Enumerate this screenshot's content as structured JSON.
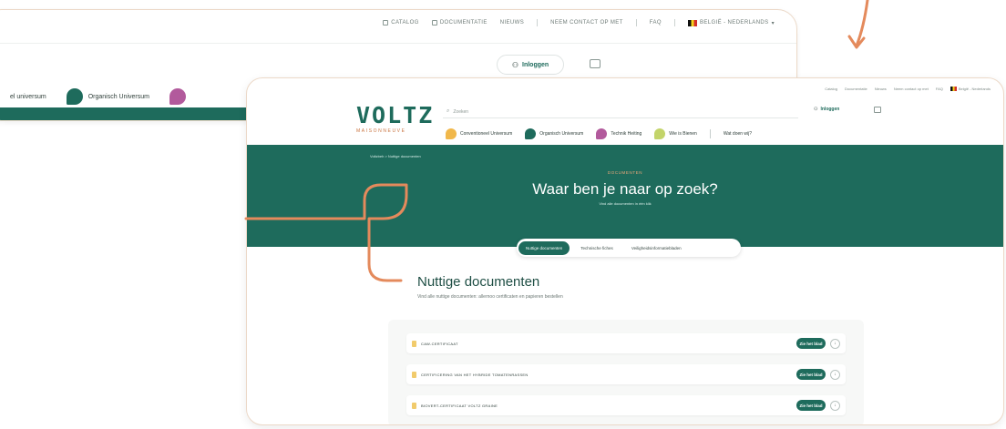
{
  "back_card": {
    "topbar": [
      "CATALOG",
      "DOCUMENTATIE",
      "NIEUWS",
      "NEEM CONTACT OP MET",
      "FAQ",
      "BELGIË - NEDERLANDS"
    ],
    "login": "Inloggen",
    "categories": [
      "el universum",
      "Organisch Universum"
    ]
  },
  "front_card": {
    "topbar": [
      "Catalog",
      "Documentatie",
      "Nieuws",
      "Neem contact op met",
      "FAQ",
      "België - Nederlands"
    ],
    "logo": {
      "name": "VOLTZ",
      "sub": "MAISONNEUVE"
    },
    "search_placeholder": "Zoeken",
    "login": "Inloggen",
    "categories": [
      {
        "label": "Conventioneel Universum",
        "color": "#f1b84b"
      },
      {
        "label": "Organisch Universum",
        "color": "#1e6b5c"
      },
      {
        "label": "Technik Heiting",
        "color": "#b25a9c"
      },
      {
        "label": "Wie is Bienen",
        "color": "#c3d46a"
      }
    ],
    "extra_link": "Wat doen wij?",
    "breadcrumb": "Voltzbeh  >  Nuttige documenten",
    "kicker": "DOCUMENTEN",
    "hero_title": "Waar ben je naar op zoek?",
    "hero_subtitle": "Vind alle documenten in één klik",
    "tabs": [
      "Nuttige documenten",
      "Technische fiches",
      "Veiligheidsinformatiebladen"
    ],
    "section_title": "Nuttige documenten",
    "section_subtitle": "Vind alle nuttige documenten: allernoo certificaten en papieren bestellen",
    "documents": [
      {
        "label": "CAW-CERTIFICAAT",
        "button": "Zie het blad"
      },
      {
        "label": "CERTIFICERING VAN HET HYBRIDE TOMATENRASSEN",
        "button": "Zie het blad"
      },
      {
        "label": "BIOVERT-CERTIFICAAT VOLTZ GRAINE",
        "button": "Zie het blad"
      }
    ]
  },
  "colors": {
    "brand": "#1e6b5c",
    "accent": "#e48a5c",
    "border": "#ecd9c8"
  }
}
